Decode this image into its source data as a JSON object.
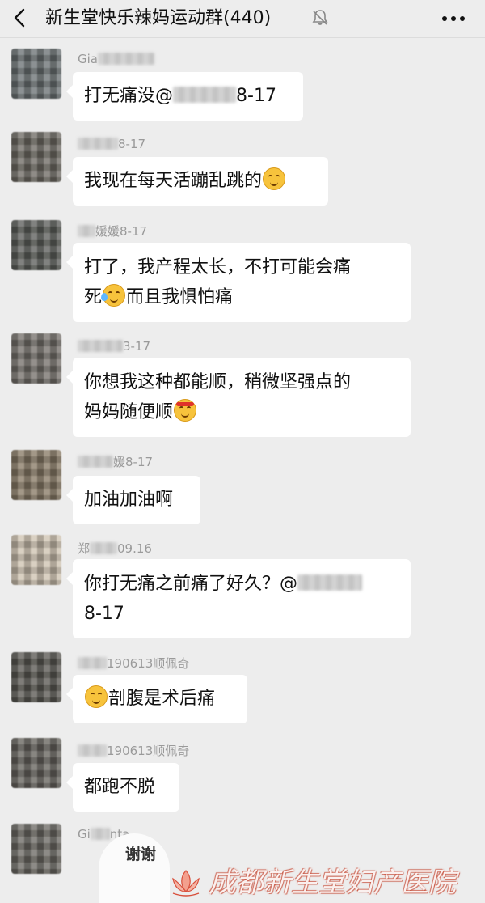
{
  "header": {
    "title": "新生堂快乐辣妈运动群(440)",
    "back_icon": "chevron-left-icon",
    "mute_icon": "bell-muted-icon",
    "more_icon": "more-dots-icon"
  },
  "messages": [
    {
      "name_visible": "Gia",
      "name_suffix": "",
      "lines": [
        "打无痛没@",
        "8-17"
      ],
      "text_before_blur": "打无痛没@",
      "text_after_blur": "8-17"
    },
    {
      "name_visible": "",
      "name_suffix": "8-17",
      "lines": [
        "我现在每天活蹦乱跳的"
      ],
      "emoji": "smile-blush-emoji"
    },
    {
      "name_visible": "",
      "name_suffix": "媛媛8-17",
      "lines": [
        "打了，我产程太长，不打可能会痛",
        "死",
        "而且我惧怕痛"
      ],
      "emoji": "sweat-laugh-emoji"
    },
    {
      "name_visible": "",
      "name_suffix": "3-17",
      "lines": [
        "你想我这种都能顺，稍微坚强点的",
        "妈妈随便顺"
      ],
      "emoji": "headband-emoji"
    },
    {
      "name_visible": "",
      "name_suffix": "媛8-17",
      "lines": [
        "加油加油啊"
      ]
    },
    {
      "name_visible": "郑",
      "name_suffix": "09.16",
      "lines": [
        "你打无痛之前痛了好久？@",
        "8-17"
      ]
    },
    {
      "name_visible": "",
      "name_suffix": "190613顺佩奇",
      "lines": [
        "剖腹是术后痛"
      ],
      "emoji": "smile-blush-emoji"
    },
    {
      "name_visible": "",
      "name_suffix": "190613顺佩奇",
      "lines": [
        "都跑不脱"
      ]
    },
    {
      "name_visible": "Gi",
      "name_suffix": "nta"
    }
  ],
  "sticker": {
    "text": "谢谢"
  },
  "watermark": {
    "text": "成都新生堂妇产医院",
    "logo_icon": "lotus-logo-icon"
  }
}
